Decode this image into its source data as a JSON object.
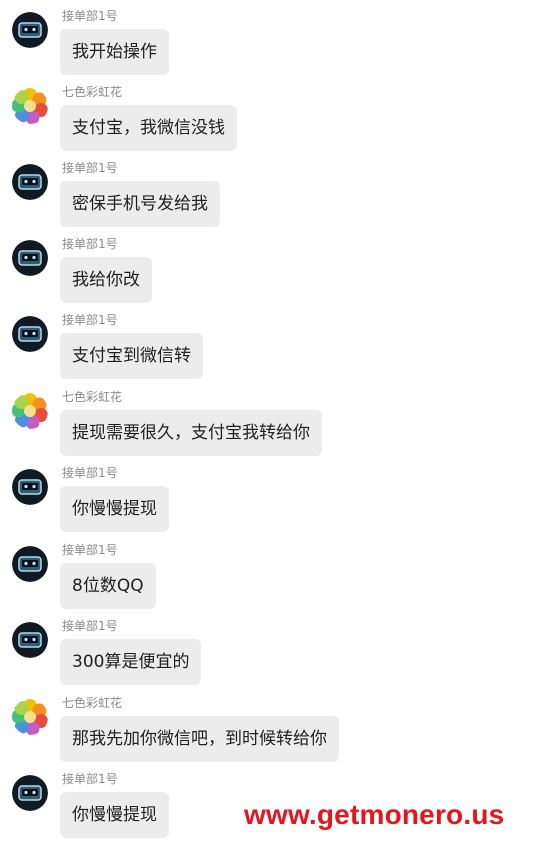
{
  "senders": {
    "operator": "接单部1号",
    "customer": "七色彩虹花"
  },
  "messages": [
    {
      "sender": "operator",
      "text": "我开始操作"
    },
    {
      "sender": "customer",
      "text": "支付宝，我微信没钱"
    },
    {
      "sender": "operator",
      "text": "密保手机号发给我"
    },
    {
      "sender": "operator",
      "text": "我给你改"
    },
    {
      "sender": "operator",
      "text": "支付宝到微信转"
    },
    {
      "sender": "customer",
      "text": "提现需要很久，支付宝我转给你"
    },
    {
      "sender": "operator",
      "text": "你慢慢提现"
    },
    {
      "sender": "operator",
      "text": "8位数QQ"
    },
    {
      "sender": "operator",
      "text": "300算是便宜的"
    },
    {
      "sender": "customer",
      "text": "那我先加你微信吧，到时候转给你"
    },
    {
      "sender": "operator",
      "text": "你慢慢提现"
    }
  ],
  "watermark": "www.getmonero.us",
  "colors": {
    "bubble": "#ececec",
    "sender_name": "#8a8a8a",
    "watermark": "#e8141b"
  },
  "icons": {
    "operator_avatar": "dark-gamepad-avatar-icon",
    "customer_avatar": "rainbow-flower-avatar-icon"
  }
}
